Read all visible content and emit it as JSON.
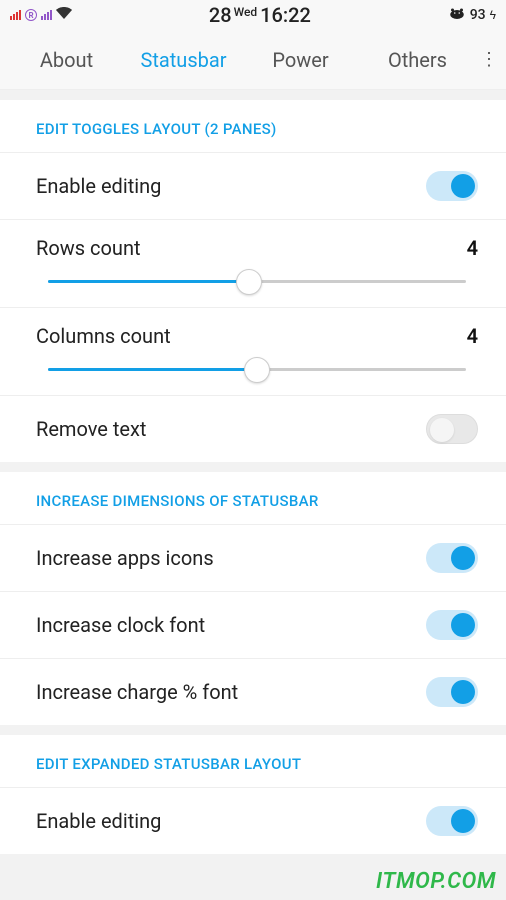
{
  "statusbar": {
    "date": "28",
    "day": "Wed",
    "time": "16:22",
    "battery": "93",
    "charging": "⚡"
  },
  "tabs": {
    "items": [
      "About",
      "Statusbar",
      "Power",
      "Others"
    ],
    "activeIndex": 1
  },
  "sections": [
    {
      "title": "EDIT TOGGLES LAYOUT (2 PANES)",
      "rows": [
        {
          "type": "toggle",
          "label": "Enable editing",
          "on": true
        },
        {
          "type": "slider",
          "label": "Rows count",
          "value": "4",
          "percent": 48
        },
        {
          "type": "slider",
          "label": "Columns count",
          "value": "4",
          "percent": 50
        },
        {
          "type": "toggle",
          "label": "Remove text",
          "on": false
        }
      ]
    },
    {
      "title": "INCREASE DIMENSIONS OF STATUSBAR",
      "rows": [
        {
          "type": "toggle",
          "label": "Increase apps icons",
          "on": true
        },
        {
          "type": "toggle",
          "label": "Increase clock font",
          "on": true
        },
        {
          "type": "toggle",
          "label": "Increase charge % font",
          "on": true
        }
      ]
    },
    {
      "title": "EDIT EXPANDED STATUSBAR LAYOUT",
      "rows": [
        {
          "type": "toggle",
          "label": "Enable editing",
          "on": true
        }
      ]
    }
  ],
  "watermark": "ITMOP.COM"
}
